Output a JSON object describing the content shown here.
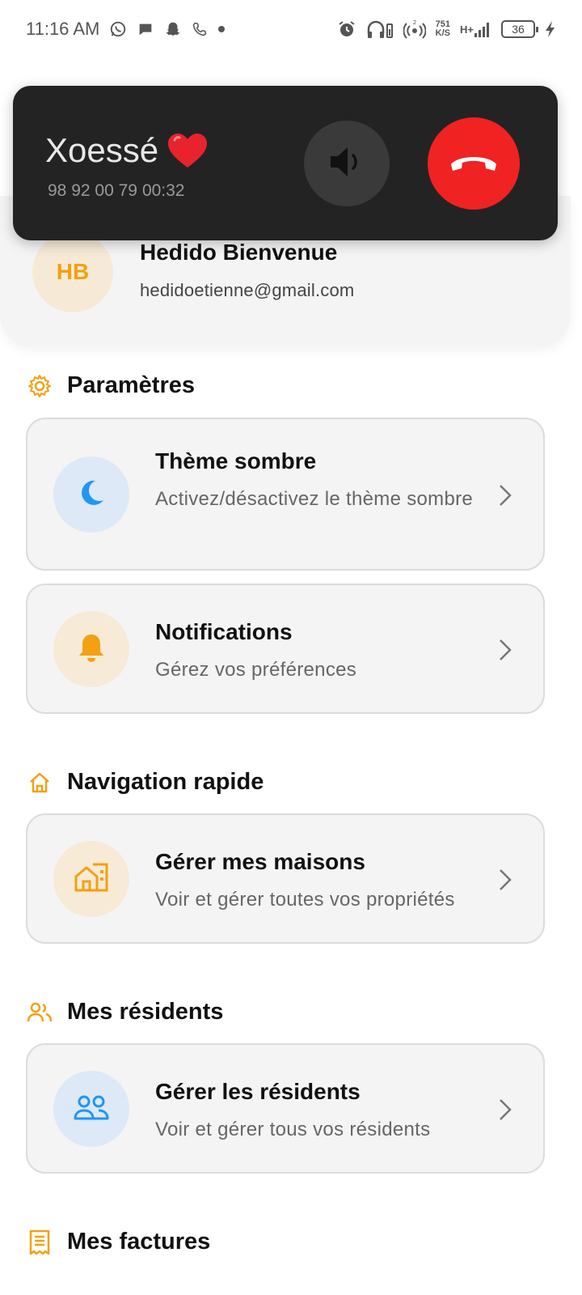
{
  "status_bar": {
    "time": "11:16 AM",
    "net_speed_value": "751",
    "net_speed_unit": "K/S",
    "net_type": "H+",
    "battery": "36",
    "sim_index": "2"
  },
  "call": {
    "caller_name": "Xoessé",
    "number": "98 92 00 79",
    "duration": "00:32"
  },
  "profile": {
    "initials": "HB",
    "name": "Hedido Bienvenue",
    "email": "hedidoetienne@gmail.com"
  },
  "sections": {
    "parametres": {
      "title": "Paramètres",
      "theme": {
        "title": "Thème sombre",
        "subtitle": "Activez/désactivez le thème sombre"
      },
      "notifications": {
        "title": "Notifications",
        "subtitle": "Gérez vos préférences"
      }
    },
    "navigation": {
      "title": "Navigation rapide",
      "maisons": {
        "title": "Gérer mes maisons",
        "subtitle": "Voir et gérer toutes vos propriétés"
      }
    },
    "residents": {
      "title": "Mes résidents",
      "gerer": {
        "title": "Gérer les résidents",
        "subtitle": "Voir et gérer tous vos résidents"
      }
    },
    "factures": {
      "title": "Mes factures"
    }
  },
  "colors": {
    "accent_orange": "#f3a012",
    "accent_blue": "#2196f3",
    "hangup_red": "#f02222",
    "call_bg": "#232323"
  },
  "icons": {
    "theme": "moon-icon",
    "notifications": "bell-icon",
    "maisons": "buildings-icon",
    "residents": "users-icon",
    "parametres": "gear-icon",
    "navigation": "home-icon",
    "residents_section": "people-icon",
    "factures": "receipt-icon"
  }
}
